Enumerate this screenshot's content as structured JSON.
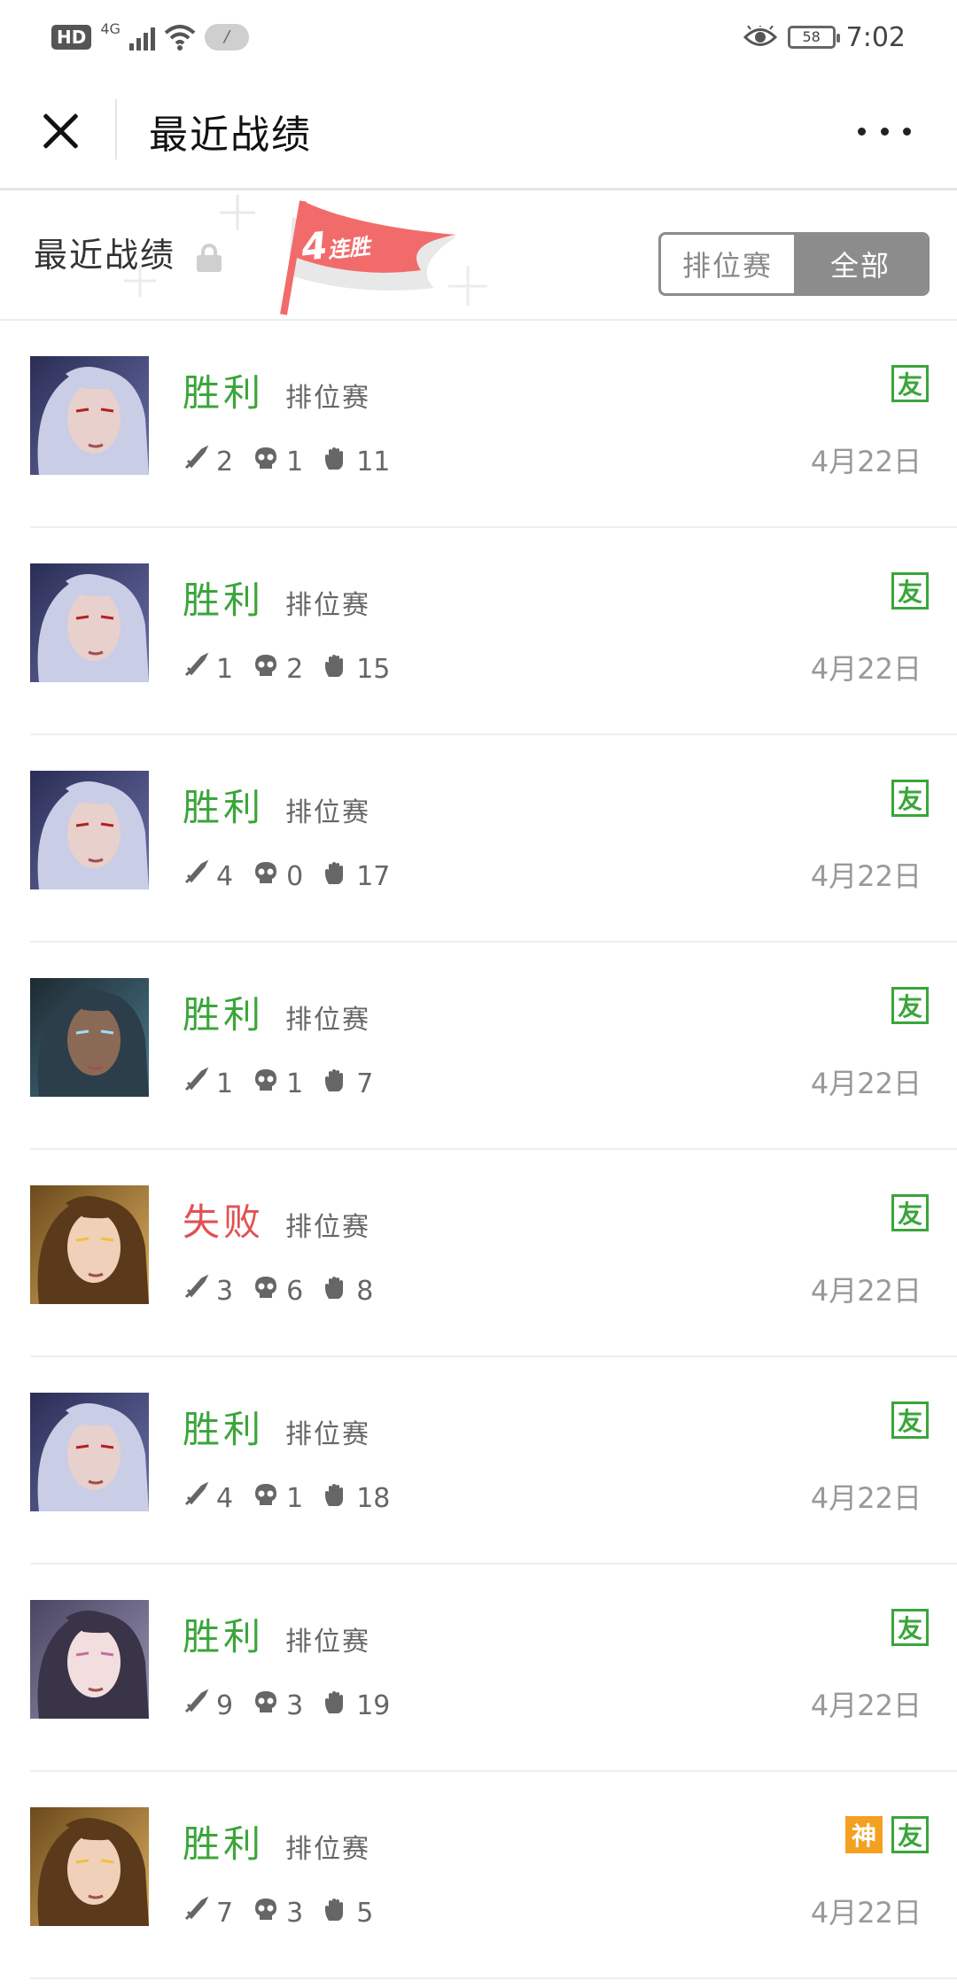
{
  "status_bar": {
    "hd": "HD",
    "network": "4G",
    "notification": "/",
    "battery": "58",
    "time": "7:02"
  },
  "header": {
    "title": "最近战绩"
  },
  "section": {
    "title": "最近战绩",
    "streak_count": "4",
    "streak_label": "连胜",
    "filters": [
      "排位赛",
      "全部"
    ],
    "active_filter": "全部"
  },
  "colors": {
    "win": "#3aa53a",
    "loss": "#e05252",
    "friend_tag": "#3aa53a",
    "god_tag": "#f4a020"
  },
  "matches": [
    {
      "result": "胜利",
      "mode": "排位赛",
      "kills": "2",
      "deaths": "1",
      "assists": "11",
      "date": "4月22日",
      "tags": [
        "友"
      ],
      "hero": "silver-haired"
    },
    {
      "result": "胜利",
      "mode": "排位赛",
      "kills": "1",
      "deaths": "2",
      "assists": "15",
      "date": "4月22日",
      "tags": [
        "友"
      ],
      "hero": "silver-haired"
    },
    {
      "result": "胜利",
      "mode": "排位赛",
      "kills": "4",
      "deaths": "0",
      "assists": "17",
      "date": "4月22日",
      "tags": [
        "友"
      ],
      "hero": "silver-haired"
    },
    {
      "result": "胜利",
      "mode": "排位赛",
      "kills": "1",
      "deaths": "1",
      "assists": "7",
      "date": "4月22日",
      "tags": [
        "友"
      ],
      "hero": "dark-glowing"
    },
    {
      "result": "失败",
      "mode": "排位赛",
      "kills": "3",
      "deaths": "6",
      "assists": "8",
      "date": "4月22日",
      "tags": [
        "友"
      ],
      "hero": "golden"
    },
    {
      "result": "胜利",
      "mode": "排位赛",
      "kills": "4",
      "deaths": "1",
      "assists": "18",
      "date": "4月22日",
      "tags": [
        "友"
      ],
      "hero": "silver-haired"
    },
    {
      "result": "胜利",
      "mode": "排位赛",
      "kills": "9",
      "deaths": "3",
      "assists": "19",
      "date": "4月22日",
      "tags": [
        "友"
      ],
      "hero": "purple-haired"
    },
    {
      "result": "胜利",
      "mode": "排位赛",
      "kills": "7",
      "deaths": "3",
      "assists": "5",
      "date": "4月22日",
      "tags": [
        "神",
        "友"
      ],
      "hero": "golden"
    }
  ]
}
